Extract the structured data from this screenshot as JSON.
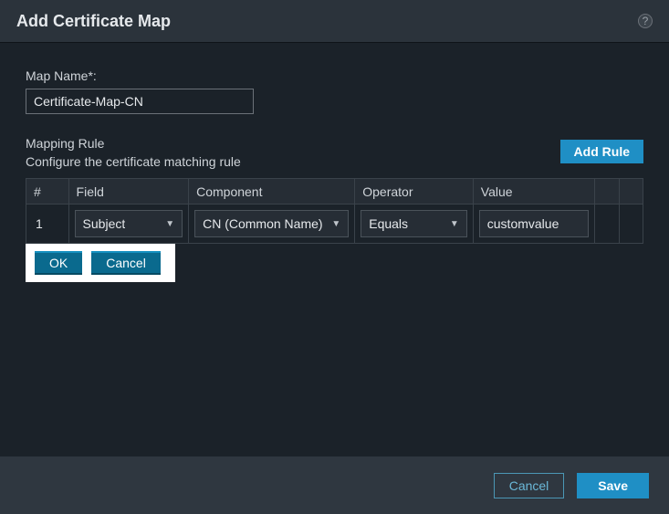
{
  "title": "Add Certificate Map",
  "help_tooltip": "?",
  "map_name": {
    "label": "Map Name*:",
    "value": "Certificate-Map-CN"
  },
  "mapping": {
    "section_title": "Mapping Rule",
    "section_sub": "Configure the certificate matching rule",
    "add_rule_label": "Add Rule",
    "columns": {
      "num": "#",
      "field": "Field",
      "component": "Component",
      "operator": "Operator",
      "value": "Value"
    },
    "rows": [
      {
        "num": "1",
        "field": "Subject",
        "component": "CN (Common Name)",
        "operator": "Equals",
        "value": "customvalue"
      }
    ],
    "row_ok_label": "OK",
    "row_cancel_label": "Cancel"
  },
  "footer": {
    "cancel_label": "Cancel",
    "save_label": "Save"
  }
}
